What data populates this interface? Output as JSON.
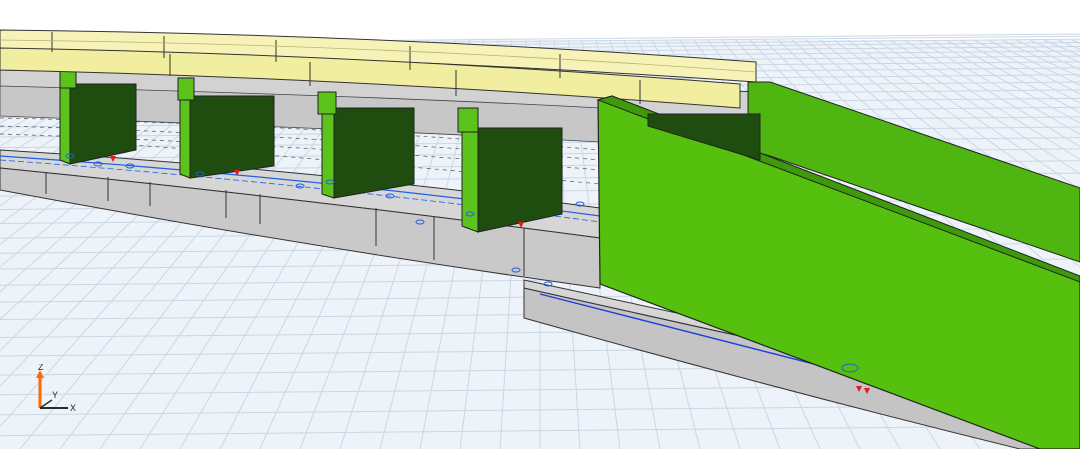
{
  "viewport": {
    "name": "3d-model-view",
    "colors": {
      "background": "#ffffff",
      "grid_line": "#c9d7e6",
      "grid_fill": "#eef3f9",
      "foundation_top": "#d6d6d6",
      "foundation_side": "#b9b9b9",
      "foundation_front": "#c9c9c9",
      "column_front": "#5cc21c",
      "column_side": "#1f4d0f",
      "beam_top": "#f7f3b8",
      "beam_side": "#e9e59a",
      "deck_under": "#d2d2d2",
      "wall_face": "#56c00e",
      "wall_top": "#3e9a0a",
      "annotation_blue": "#1f5fe0",
      "annotation_red": "#e31b1b"
    }
  },
  "axis_triad": {
    "z_label": "Z",
    "y_label": "Y",
    "x_label": "X",
    "z_color": "#ff6a00",
    "x_color": "#2b2b2b",
    "y_color": "#2b2b2b"
  }
}
